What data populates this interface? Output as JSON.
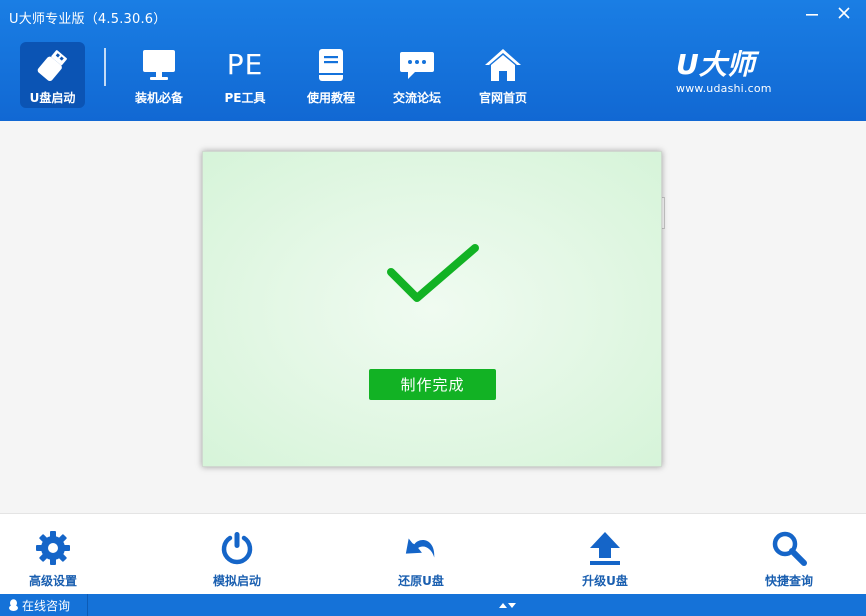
{
  "window": {
    "title": "U大师专业版（4.5.30.6）"
  },
  "nav": {
    "items": [
      {
        "label": "U盘启动",
        "icon": "usb-drive-icon",
        "active": true
      },
      {
        "label": "装机必备",
        "icon": "monitor-icon"
      },
      {
        "label": "PE工具",
        "icon": "pe-icon",
        "glyph": "PE"
      },
      {
        "label": "使用教程",
        "icon": "book-icon"
      },
      {
        "label": "交流论坛",
        "icon": "chat-bubble-icon"
      },
      {
        "label": "官网首页",
        "icon": "home-icon"
      }
    ]
  },
  "brand": {
    "logo": "U大师",
    "url": "www.udashi.com"
  },
  "dialog": {
    "status_icon": "checkmark-icon",
    "button_label": "制作完成"
  },
  "toolbar": {
    "items": [
      {
        "label": "高级设置",
        "icon": "gear-icon"
      },
      {
        "label": "模拟启动",
        "icon": "power-icon"
      },
      {
        "label": "还原U盘",
        "icon": "undo-arrow-icon"
      },
      {
        "label": "升级U盘",
        "icon": "upload-icon"
      },
      {
        "label": "快捷查询",
        "icon": "magnifier-icon"
      }
    ]
  },
  "statusbar": {
    "consult_label": "在线咨询"
  },
  "colors": {
    "header_blue": "#1a7ee4",
    "active_tab": "#0b54b4",
    "success_green": "#12b224",
    "toolbar_text": "#1a5fb0"
  }
}
